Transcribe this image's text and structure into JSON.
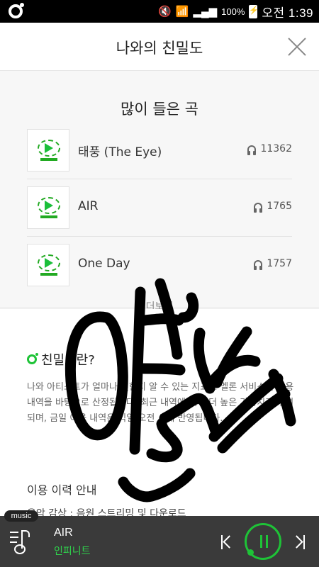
{
  "status_bar": {
    "battery": "100%",
    "time": "오전 1:39",
    "icons": [
      "mute-icon",
      "wifi-icon",
      "signal-icon",
      "battery-icon"
    ]
  },
  "header": {
    "title": "나와의 친밀도",
    "close_icon": "close-icon"
  },
  "top_songs": {
    "heading": "많이 들은 곡",
    "songs": [
      {
        "title": "태풍 (The Eye)",
        "plays": "11362"
      },
      {
        "title": "AIR",
        "plays": "1765"
      },
      {
        "title": "One Day",
        "plays": "1757"
      }
    ],
    "more_label": "더보기"
  },
  "info": {
    "title": "친밀도란?",
    "body": "나와 아티스트가 얼마나 친한지 알 수 있는 지표로 멜론 서비스의 이용 내역을 바탕으로 산정됩니다. 최근 내역에 대해 더 높은 가중치가 부여되며, 금일 이용 내역은 익일 오전 시에 반영됩니다.",
    "sub_title": "이용 이력 안내",
    "detail": "음악 감상 : 음원 스트리밍 및 다운로드"
  },
  "player": {
    "tab_label": "music",
    "track_title": "AIR",
    "artist": "인피니트"
  },
  "colors": {
    "accent": "#1ec337",
    "player_bg": "#3a3a3a",
    "scribble": "#000000"
  }
}
